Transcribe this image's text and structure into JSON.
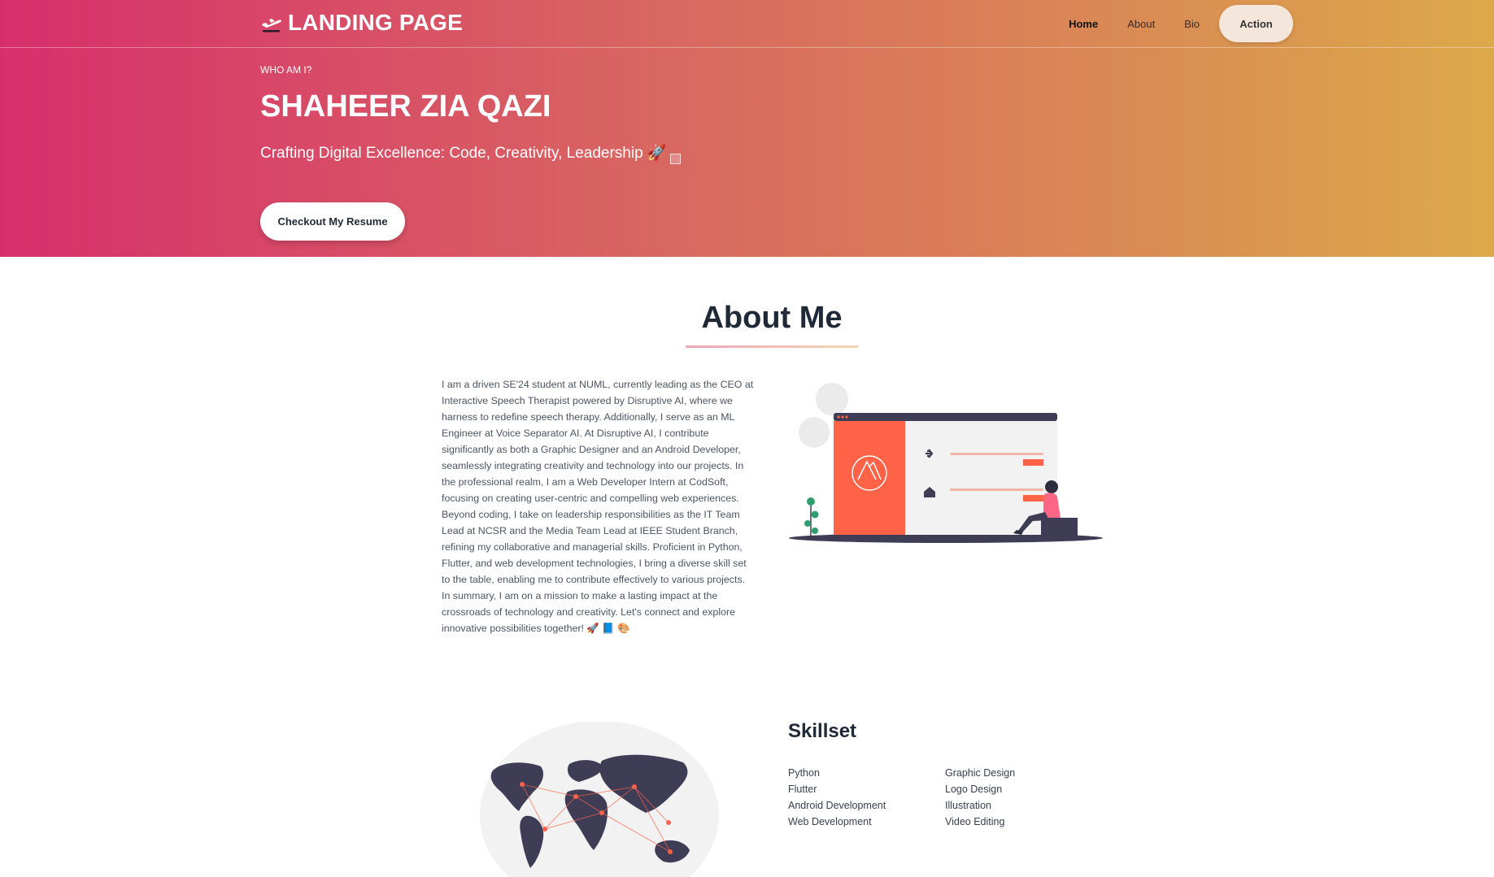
{
  "nav": {
    "brand": "LANDING PAGE",
    "brand_icon": "airplane-takeoff-icon",
    "links": [
      "Home",
      "About",
      "Bio"
    ],
    "action_label": "Action"
  },
  "hero": {
    "eyebrow": "WHO AM I?",
    "name": "SHAHEER ZIA QAZI",
    "tagline": "Crafting Digital Excellence: Code, Creativity, Leadership 🚀",
    "resume_button": "Checkout My Resume",
    "gradient_start": "#d72f6c",
    "gradient_end": "#dca94a"
  },
  "about": {
    "title": "About Me",
    "body": "I am a driven SE'24 student at NUML, currently leading as the CEO at Interactive Speech Therapist powered by Disruptive AI, where we harness to redefine speech therapy. Additionally, I serve as an ML Engineer at Voice Separator AI. At Disruptive AI, I contribute significantly as both a Graphic Designer and an Android Developer, seamlessly integrating creativity and technology into our projects. In the professional realm, I am a Web Developer Intern at CodSoft, focusing on creating user-centric and compelling web experiences. Beyond coding, I take on leadership responsibilities as the IT Team Lead at NCSR and the Media Team Lead at IEEE Student Branch, refining my collaborative and managerial skills. Proficient in Python, Flutter, and web development technologies, I bring a diverse skill set to the table, enabling me to contribute effectively to various projects. In summary, I am on a mission to make a lasting impact at the crossroads of technology and creativity. Let's connect and explore innovative possibilities together! 🚀 📘 🎨",
    "accent_color": "#ff6347"
  },
  "skills": {
    "title": "Skillset",
    "column1": [
      "Python",
      "Flutter",
      "Android Development",
      "Web Development"
    ],
    "column2": [
      "Graphic Design",
      "Logo Design",
      "Illustration",
      "Video Editing"
    ]
  }
}
